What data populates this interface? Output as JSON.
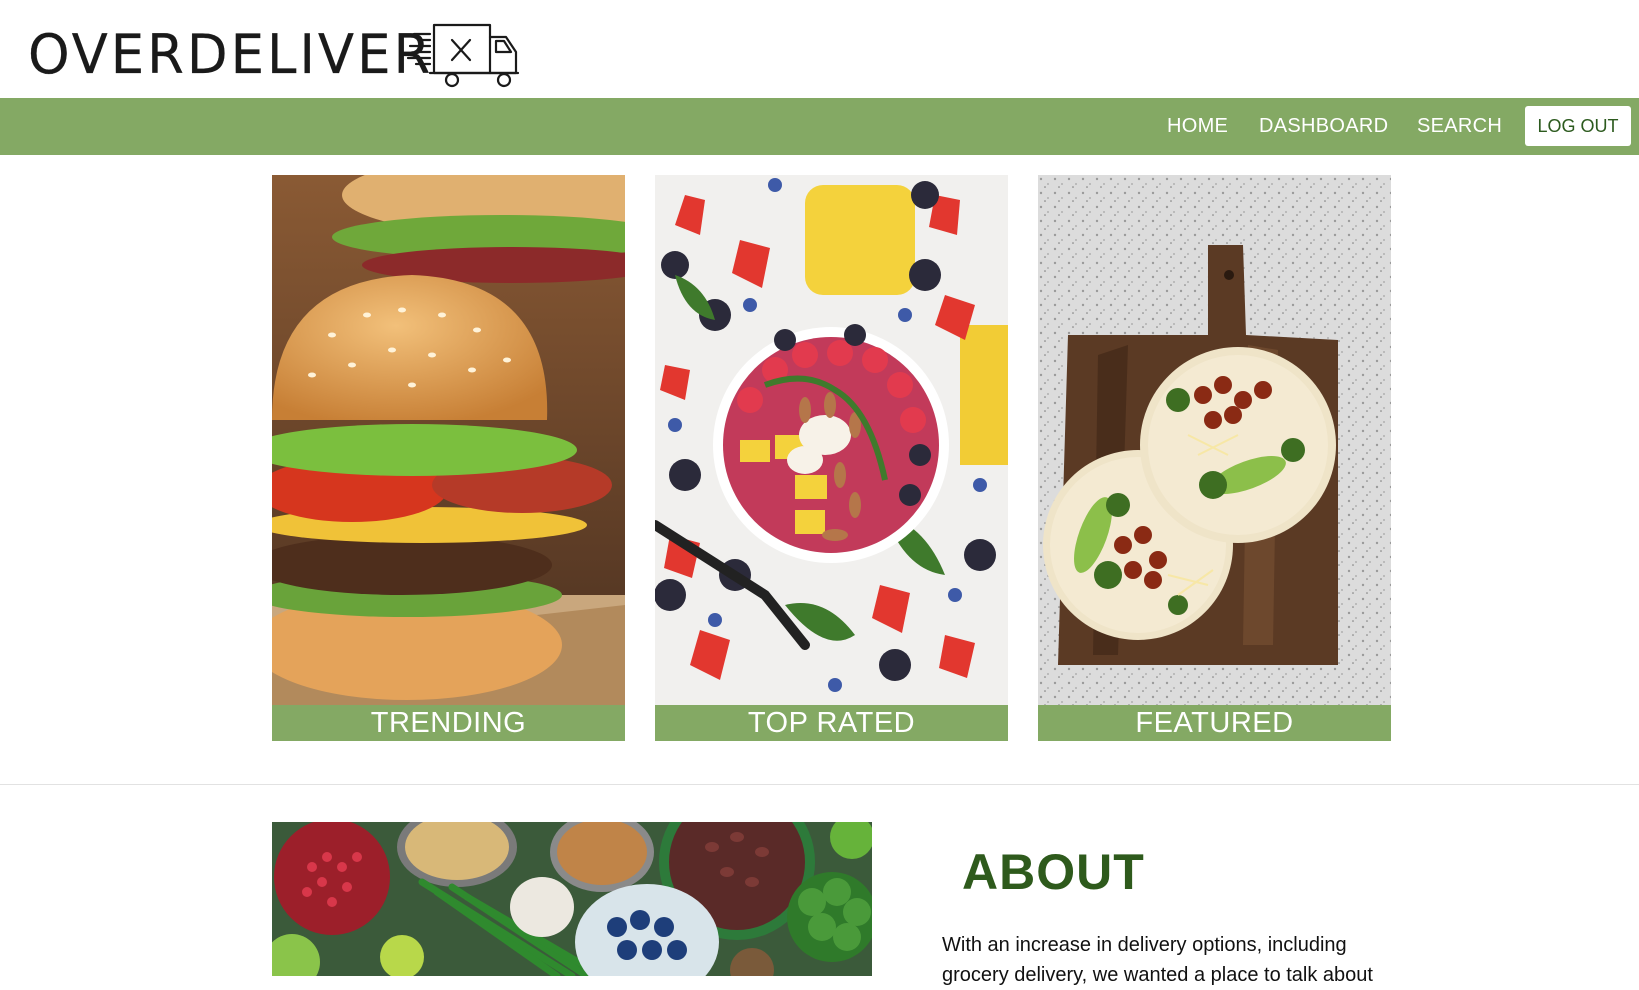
{
  "brand": {
    "name": "OVERDELIVER",
    "icon": "delivery-truck-icon"
  },
  "nav": {
    "home": "HOME",
    "dashboard": "DASHBOARD",
    "search": "SEARCH",
    "logout": "LOG OUT"
  },
  "cards": [
    {
      "label": "TRENDING",
      "image": "burger-photo"
    },
    {
      "label": "TOP RATED",
      "image": "fruit-smoothie-bowl-photo"
    },
    {
      "label": "FEATURED",
      "image": "tacos-on-board-photo"
    }
  ],
  "about": {
    "title": "ABOUT",
    "image": "vegetables-and-grains-photo",
    "text": "With an increase in delivery options, including grocery delivery, we wanted a place to talk about"
  },
  "colors": {
    "accent": "#84a964",
    "heading": "#2e5a1c",
    "background": "#ffffff"
  }
}
